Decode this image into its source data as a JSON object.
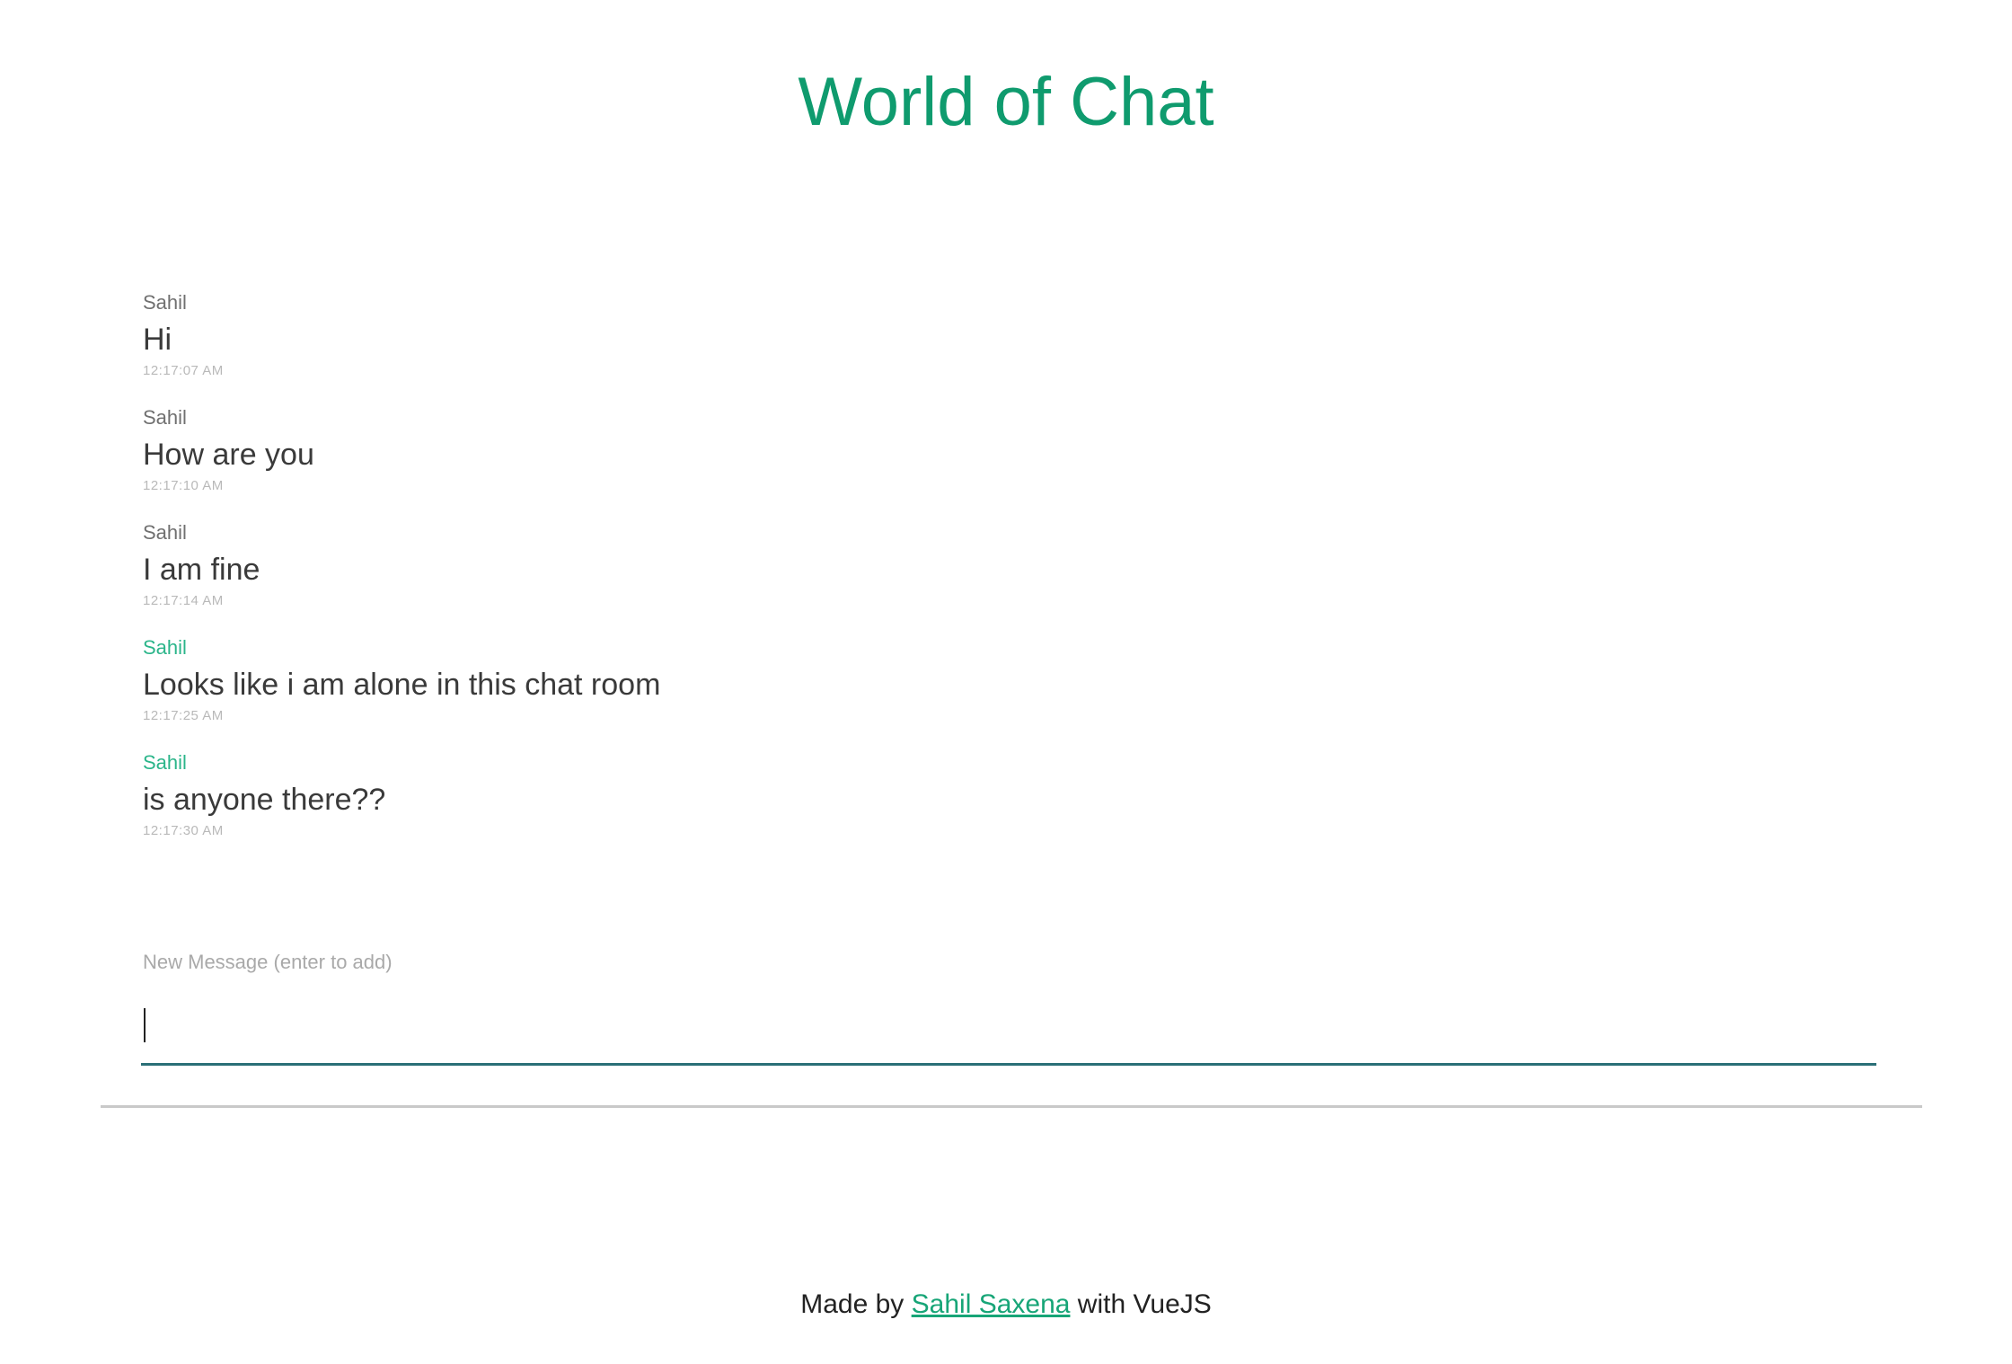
{
  "header": {
    "title": "World of Chat"
  },
  "messages": [
    {
      "author": "Sahil",
      "text": "Hi",
      "time": "12:17:07 AM"
    },
    {
      "author": "Sahil",
      "text": "How are you",
      "time": "12:17:10 AM"
    },
    {
      "author": "Sahil",
      "text": "I am fine",
      "time": "12:17:14 AM"
    },
    {
      "author": "Sahil",
      "text": "Looks like i am alone in this chat room",
      "time": "12:17:25 AM"
    },
    {
      "author": "Sahil",
      "text": "is anyone there??",
      "time": "12:17:30 AM"
    }
  ],
  "composer": {
    "label": "New Message (enter to add)",
    "value": ""
  },
  "footer": {
    "prefix": "Made by",
    "author_link": "Sahil Saxena",
    "suffix": "with VueJS"
  },
  "colors": {
    "accent": "#0f9b6e",
    "input_underline": "#2b6f77",
    "divider": "#c9c9c9"
  }
}
